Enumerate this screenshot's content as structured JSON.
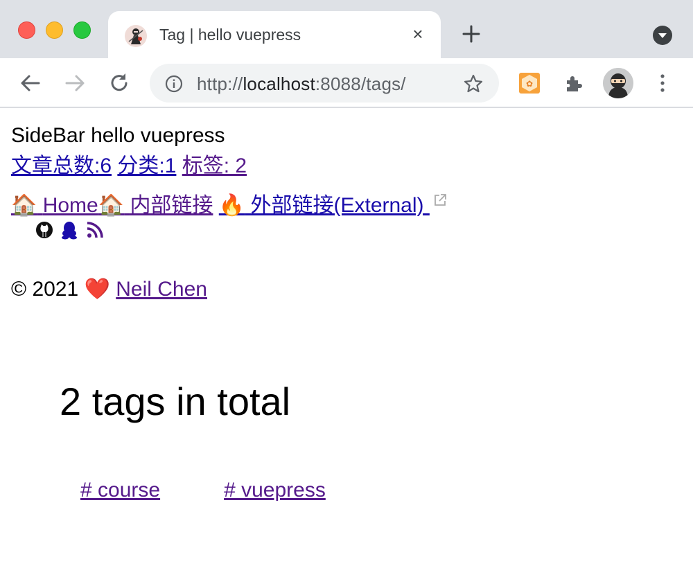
{
  "browser": {
    "tab_title": "Tag | hello vuepress",
    "tab_close": "×",
    "url_scheme": "http://",
    "url_host": "localhost",
    "url_rest": ":8088/tags/",
    "colors": {
      "tabstrip": "#dee1e6",
      "omnibox": "#f1f3f4"
    }
  },
  "page": {
    "site_title": "SideBar hello vuepress",
    "stats": [
      {
        "label": "文章总数:6"
      },
      {
        "label": "分类:1"
      },
      {
        "label": "标签: 2"
      }
    ],
    "nav": {
      "home_emoji": "🏠",
      "home_label": "Home",
      "internal_emoji": "🏠",
      "internal_label": "内部链接",
      "external_emoji": "🔥",
      "external_label": "外部链接(External)"
    },
    "social_icons": [
      "github-icon",
      "qq-icon",
      "rss-icon"
    ],
    "footer": {
      "copyright": "© 2021",
      "heart": "❤️",
      "author": "Neil Chen"
    },
    "tags_total": "2 tags in total",
    "tags": [
      {
        "label": "# course"
      },
      {
        "label": "# vuepress"
      }
    ],
    "colors": {
      "link": "#1a0dab",
      "visited_link": "#551a8b",
      "heart": "#e0142a"
    }
  }
}
